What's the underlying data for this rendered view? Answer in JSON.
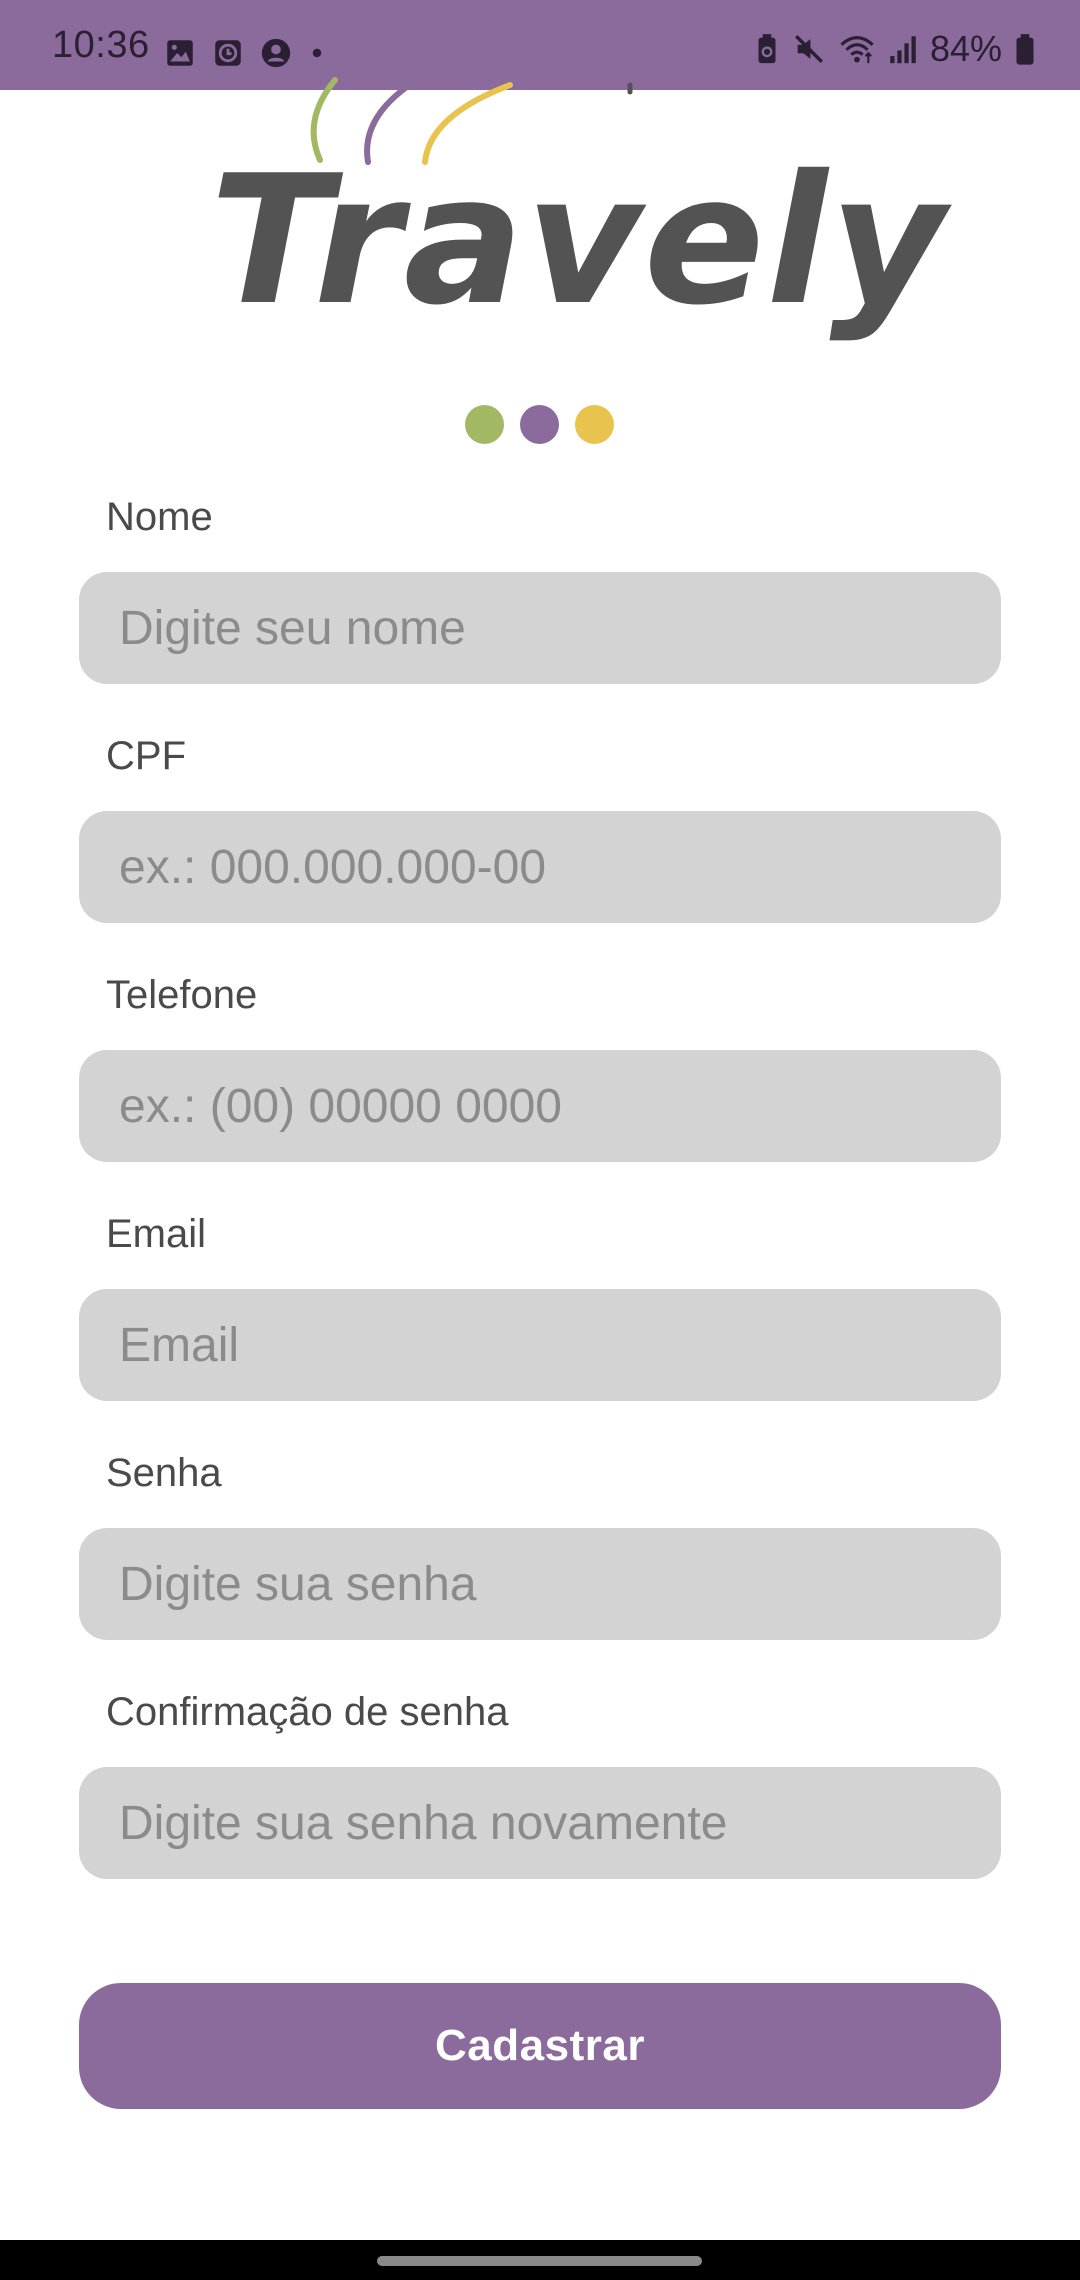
{
  "status_bar": {
    "time": "10:36",
    "battery_text": "84%",
    "left_icons": [
      "image-icon",
      "alarm-clock-icon",
      "account-icon",
      "dot-icon"
    ],
    "right_icons": [
      "battery-saver-icon",
      "mute-icon",
      "wifi-icon",
      "signal-icon",
      "battery-icon"
    ],
    "background": "#8b6a9c"
  },
  "logo": {
    "text": "Travely",
    "text_color": "#535353",
    "swoosh_colors": [
      "#a3b863",
      "#8b6a9c",
      "#e8c34e"
    ]
  },
  "page_indicator": {
    "colors": [
      "#a3b863",
      "#8b6a9c",
      "#e8c34e"
    ]
  },
  "form": {
    "fields": [
      {
        "label": "Nome",
        "placeholder": "Digite seu nome",
        "value": ""
      },
      {
        "label": "CPF",
        "placeholder": "ex.: 000.000.000-00",
        "value": ""
      },
      {
        "label": "Telefone",
        "placeholder": "ex.: (00) 00000 0000",
        "value": ""
      },
      {
        "label": "Email",
        "placeholder": "Email",
        "value": ""
      },
      {
        "label": "Senha",
        "placeholder": "Digite sua senha",
        "value": ""
      },
      {
        "label": "Confirmação de senha",
        "placeholder": "Digite sua senha novamente",
        "value": ""
      }
    ],
    "submit_label": "Cadastrar"
  },
  "colors": {
    "accent": "#8b6a9c",
    "input_background": "#d3d3d3",
    "placeholder_text": "#8b8b8b",
    "label_text": "#4a4a4a"
  }
}
